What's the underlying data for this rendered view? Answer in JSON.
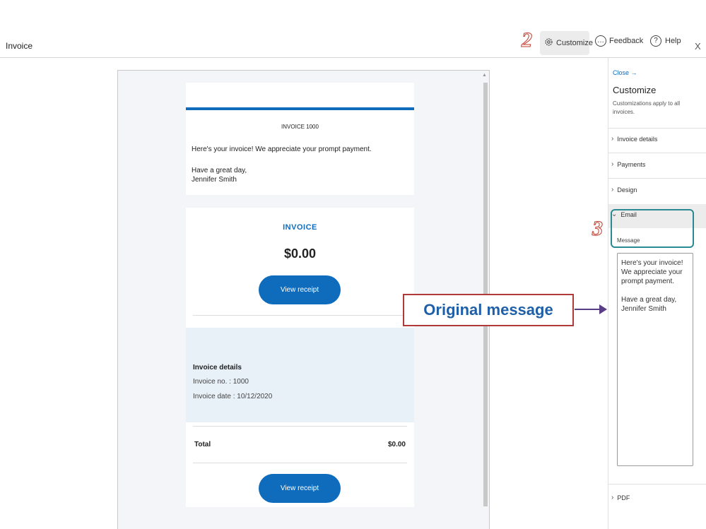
{
  "header": {
    "title": "Invoice",
    "annotation_step_2": "2",
    "customize_label": "Customize",
    "feedback_label": "Feedback",
    "help_label": "Help",
    "close_label": "X"
  },
  "email_preview": {
    "invoice_number": "INVOICE 1000",
    "message": "Here's your invoice! We appreciate your prompt payment.",
    "sign_off_line1": "Have a great day,",
    "sign_off_line2": "Jennifer Smith"
  },
  "invoice_card": {
    "label": "INVOICE",
    "amount": "$0.00",
    "button_label": "View receipt"
  },
  "invoice_details": {
    "title": "Invoice details",
    "invoice_no": "Invoice no. : 1000",
    "invoice_date": "Invoice date : 10/12/2020"
  },
  "total": {
    "label": "Total",
    "value": "$0.00",
    "button_label": "View receipt"
  },
  "annotation": {
    "original_message": "Original message",
    "step_3": "3"
  },
  "sidebar": {
    "close_label": "Close →",
    "title": "Customize",
    "subtitle": "Customizations apply to all invoices.",
    "sections": [
      {
        "label": "Invoice details"
      },
      {
        "label": "Payments"
      },
      {
        "label": "Design"
      },
      {
        "label": "Email"
      }
    ],
    "message_label": "Message",
    "message_value": "Here's your invoice! We appreciate your prompt payment.\n\nHave a great day,\nJennifer Smith",
    "pdf_label": "PDF"
  },
  "colors": {
    "accent": "#0f6cbd",
    "annotation_red": "#b03a3a",
    "annotation_teal": "#2a8a92",
    "arrow_purple": "#5a3d87"
  }
}
